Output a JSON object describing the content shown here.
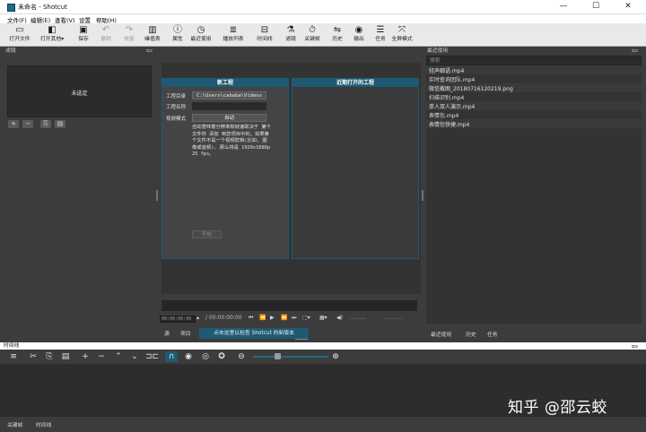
{
  "window": {
    "title": "未命名 - Shotcut",
    "min": "—",
    "max": "☐",
    "close": "✕"
  },
  "menu": [
    "文件(F)",
    "编辑(E)",
    "查看(V)",
    "设置",
    "帮助(H)"
  ],
  "toolbar": [
    {
      "icon": "▭",
      "label": "打开文件",
      "name": "open-file",
      "disabled": false
    },
    {
      "icon": "◧",
      "label": "打开其他▾",
      "name": "open-other",
      "disabled": false
    },
    {
      "icon": "▣",
      "label": "保存",
      "name": "save",
      "disabled": false
    },
    {
      "icon": "↶",
      "label": "撤销",
      "name": "undo",
      "disabled": true
    },
    {
      "icon": "↷",
      "label": "恢复",
      "name": "redo",
      "disabled": true
    },
    {
      "icon": "▥",
      "label": "峰值表",
      "name": "peak-meter",
      "disabled": false
    },
    {
      "icon": "ⓘ",
      "label": "属性",
      "name": "properties",
      "disabled": false
    },
    {
      "icon": "◷",
      "label": "最近使用",
      "name": "recent",
      "disabled": false
    },
    {
      "icon": "≣",
      "label": "播放列表",
      "name": "playlist",
      "disabled": false
    },
    {
      "icon": "⊟",
      "label": "时间线",
      "name": "timeline",
      "disabled": false
    },
    {
      "icon": "⚗",
      "label": "滤镜",
      "name": "filters",
      "disabled": false
    },
    {
      "icon": "⏱",
      "label": "关键帧",
      "name": "keyframes",
      "disabled": false
    },
    {
      "icon": "⇋",
      "label": "历史",
      "name": "history",
      "disabled": false
    },
    {
      "icon": "◉",
      "label": "输出",
      "name": "export",
      "disabled": false
    },
    {
      "icon": "☰",
      "label": "任务",
      "name": "jobs",
      "disabled": false
    },
    {
      "icon": "⤧",
      "label": "全屏模式",
      "name": "fullscreen",
      "disabled": false
    }
  ],
  "filters": {
    "title": "滤镜",
    "empty": "未选定",
    "buttons": [
      "+",
      "−",
      "⎘",
      "▤"
    ]
  },
  "new_project": {
    "title": "新工程",
    "folder_label": "工程目录",
    "folder_value": "C:\\Users\\cababa\\Videos",
    "name_label": "工程名称",
    "name_value": "",
    "mode_label": "视频模式",
    "mode_value": "自动",
    "description": "自动意味着分辨率和帧速取决于 第个 文件你 添加 到您项目中的。如果第个文件不是一个视频剪辑(比如, 图像或音频), 那么将是 1920x1080p 25 fps。",
    "start_label": "开始"
  },
  "recent_projects": {
    "title": "近期打开的工程"
  },
  "transport": {
    "timecode_current": "00:00:00:00",
    "timecode_total": "/ 00:00:00:00",
    "in_point": "--:--:--:--",
    "out_point": "--:--:--:--"
  },
  "source_tabs": [
    "源",
    "项目"
  ],
  "update_banner": "点击这里以检查 Shotcut 的新版本",
  "recent_files": {
    "title": "最近使用",
    "search_placeholder": "搜索",
    "items": [
      "轻声细语.mp4",
      "实时查询团队.mp4",
      "微信截图_20180716120219.png",
      "扫描识别.mp4",
      "单人双人演示.mp4",
      "表情包.mp4",
      "表情包快捷.mp4"
    ]
  },
  "right_tabs": [
    "最近使用",
    "历史",
    "任务"
  ],
  "timeline": {
    "title": "时间线"
  },
  "bottom_tabs": [
    "关键帧",
    "时间线"
  ],
  "watermark": "知乎 @邵云蛟",
  "colors": {
    "accent": "#1e5a73",
    "panel": "#3c3c3c",
    "dark": "#2b2b2b"
  }
}
